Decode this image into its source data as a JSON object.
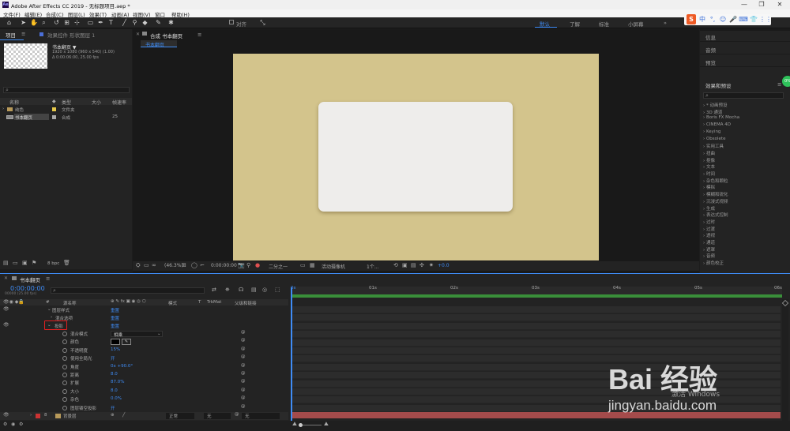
{
  "window": {
    "title": "Adobe After Effects CC 2019 - 无标题项目.aep *",
    "controls": [
      "—",
      "❐",
      "✕"
    ]
  },
  "menu": [
    "文件(F)",
    "编辑(E)",
    "合成(C)",
    "图层(L)",
    "效果(T)",
    "动画(A)",
    "视图(V)",
    "窗口",
    "帮助(H)"
  ],
  "toolbar": {
    "align_label": "对齐",
    "workspaces": [
      "默认",
      "了解",
      "标准",
      "小屏幕"
    ],
    "more": "»"
  },
  "project_panel": {
    "tab_project": "项目",
    "tab_effects": "效果控件 形状图层 1",
    "comp_name": "书本翻页 ▼",
    "comp_info1": "1920 x 1080 (960 x 540) (1.00)",
    "comp_info2": "Δ 0:00:06:00, 25.00 fps",
    "search_icon": "⌕",
    "col_name": "名称",
    "col_type": "类型",
    "col_size": "大小",
    "col_rate": "帧速率",
    "rows": [
      {
        "name": "纯色",
        "type": "文件夹",
        "size": "",
        "rate": "",
        "color": "#e6c84a"
      },
      {
        "name": "书本翻页",
        "type": "合成",
        "size": "",
        "rate": "25",
        "color": "#a9a9a9"
      }
    ],
    "bpc": "8 bpc"
  },
  "viewer": {
    "tab": "合成 书本翻页",
    "sub_tab": "书本翻页",
    "zoom": "(46.3%)",
    "timecode": "0:00:00:00",
    "resolution": "二分之一",
    "camera": "活动摄像机",
    "views": "1个...",
    "exposure": "+0.0",
    "comp_bg_color": "#d3c48c",
    "card_color": "#eeedeb"
  },
  "right_panel": {
    "items": [
      "信息",
      "音频",
      "预览"
    ],
    "effects_title": "效果和预设",
    "effects": [
      "* 动画预设",
      "3D 通道",
      "Boris FX Mocha",
      "CINEMA 4D",
      "Keying",
      "Obsolete",
      "实用工具",
      "扭曲",
      "抠像",
      "文本",
      "时间",
      "杂色和颗粒",
      "模拟",
      "模糊和锐化",
      "沉浸式视频",
      "生成",
      "表达式控制",
      "过时",
      "过渡",
      "透视",
      "通道",
      "遮罩",
      "音频",
      "颜色校正"
    ],
    "badge": "0%"
  },
  "timeline": {
    "tab": "书本翻页",
    "timecode": "0:00:00:00",
    "timecode_sub": "00000 (25.00 fps)",
    "col_source": "源名称",
    "col_mode": "模式",
    "col_t": "T",
    "col_trkmat": "TrkMat",
    "col_parent": "父级和链接",
    "ruler": [
      "0s",
      "01s",
      "02s",
      "03s",
      "04s",
      "05s",
      "06s"
    ],
    "layer_styles": "图层样式",
    "reset": "重置",
    "blend_options": "混合选项",
    "drop_shadow": "投影",
    "props": [
      {
        "name": "混合模式",
        "value": "相乘"
      },
      {
        "name": "颜色",
        "value": ""
      },
      {
        "name": "不透明度",
        "value": "15%"
      },
      {
        "name": "使用全局光",
        "value": "开"
      },
      {
        "name": "角度",
        "value": "0x +90.0°"
      },
      {
        "name": "距离",
        "value": "8.0"
      },
      {
        "name": "扩展",
        "value": "87.0%"
      },
      {
        "name": "大小",
        "value": "8.0"
      },
      {
        "name": "杂色",
        "value": "0.0%"
      },
      {
        "name": "图层镂空投影",
        "value": "开"
      }
    ],
    "bottom_layer": {
      "index": "8",
      "name": "背景层",
      "mode": "正常",
      "trkmat": "无",
      "parent": "无"
    }
  },
  "watermark": {
    "brand": "Bai 经验",
    "url": "jingyan.baidu.com",
    "sub": "激活 Windows"
  },
  "sogou": [
    "S",
    "中",
    "°,",
    "☺",
    "🎤",
    "⌨",
    "👕",
    "⋮⋮"
  ]
}
